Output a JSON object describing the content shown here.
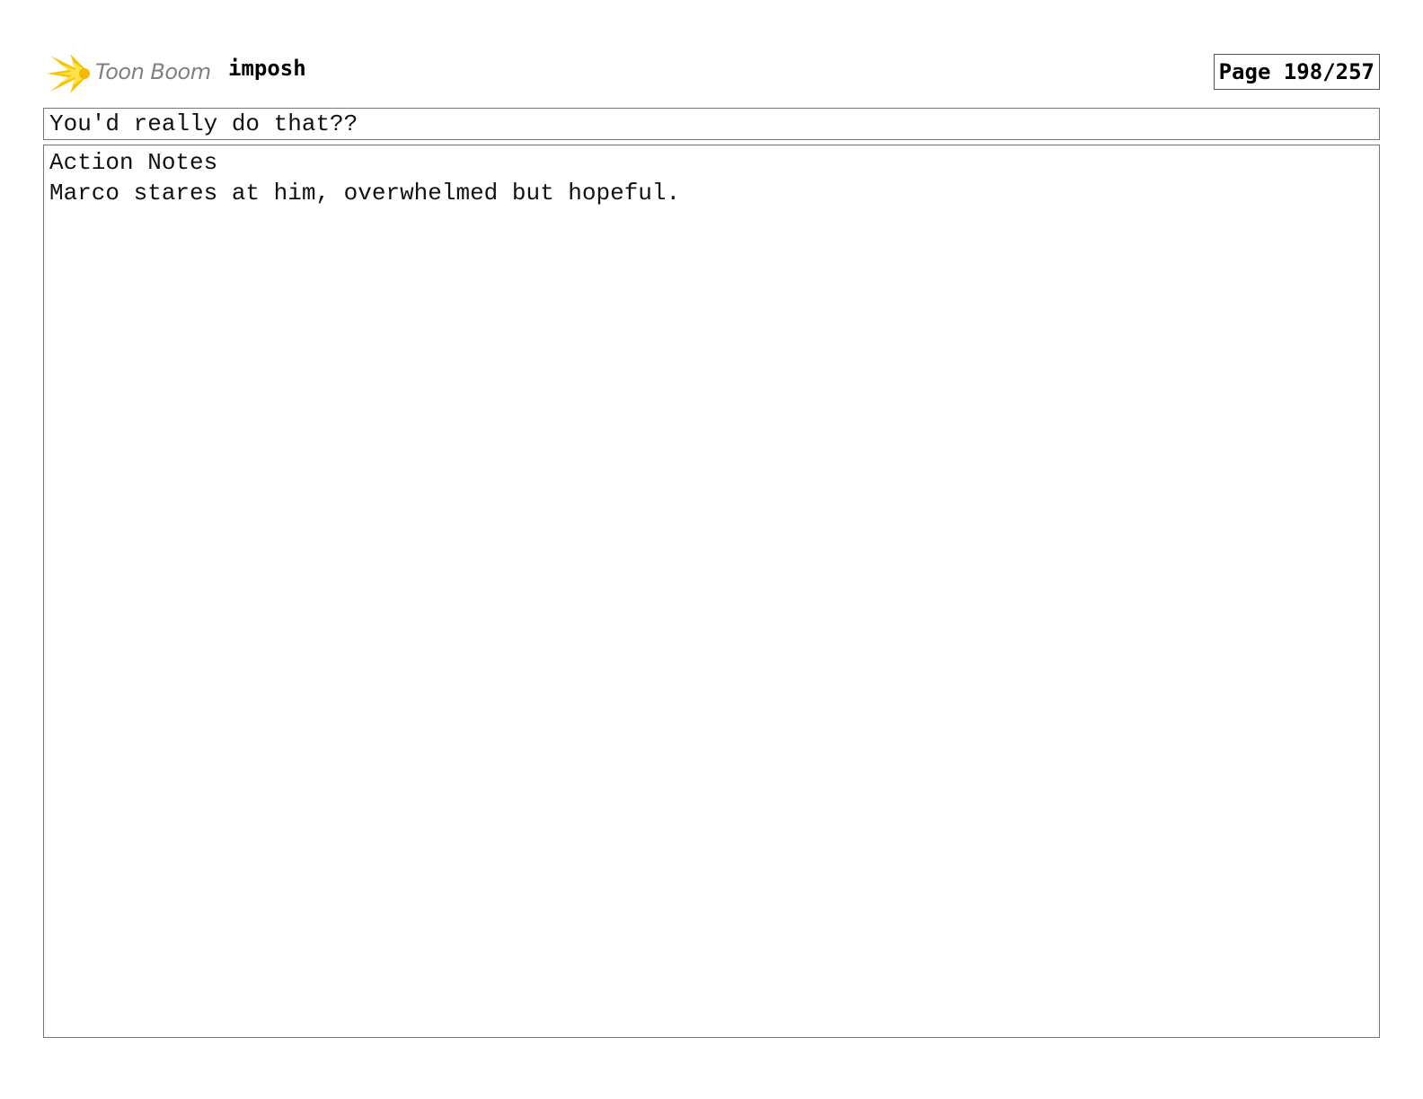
{
  "header": {
    "logo": {
      "brand_text": "Toon Boom",
      "icon": "toon-boom-star-burst-icon",
      "icon_color": "#f5c400"
    },
    "project_title": "imposh",
    "page_number": "Page 198/257"
  },
  "panel": {
    "dialogue": "You'd really do that??",
    "notes_heading": "Action Notes",
    "notes_text": "Marco stares at him, overwhelmed but hopeful."
  }
}
